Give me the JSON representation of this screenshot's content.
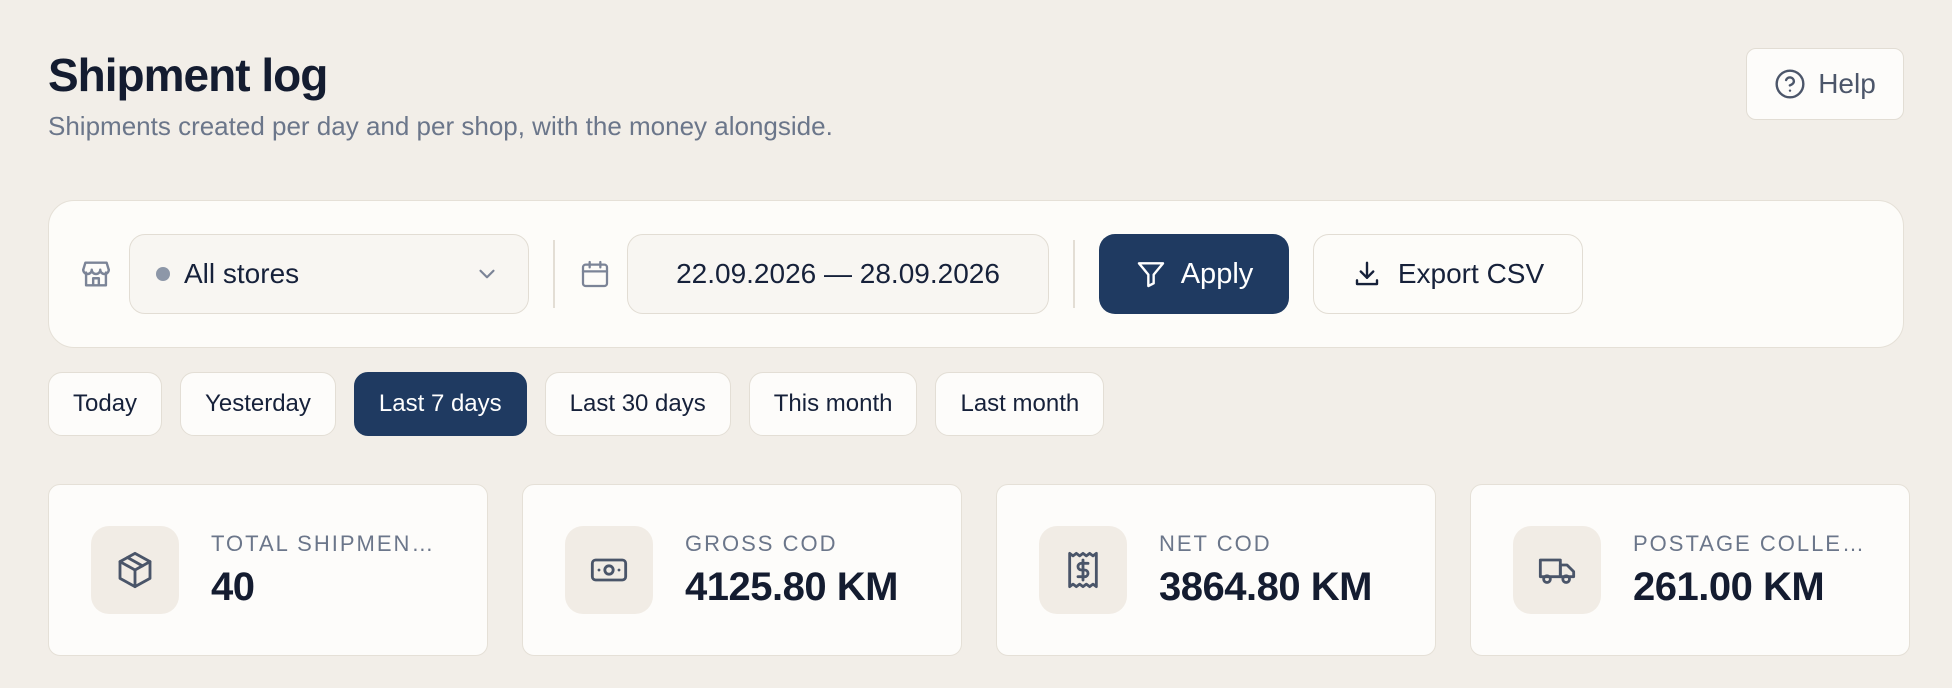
{
  "header": {
    "title": "Shipment log",
    "subtitle": "Shipments created per day and per shop, with the money alongside."
  },
  "help": {
    "label": "Help",
    "icon": "help-circle-icon"
  },
  "filters": {
    "store_icon": "store-icon",
    "store_select": {
      "value": "All stores"
    },
    "calendar_icon": "calendar-icon",
    "date_range": "22.09.2026 — 28.09.2026",
    "apply_label": "Apply",
    "export_label": "Export CSV"
  },
  "presets": [
    {
      "label": "Today",
      "active": false
    },
    {
      "label": "Yesterday",
      "active": false
    },
    {
      "label": "Last 7 days",
      "active": true
    },
    {
      "label": "Last 30 days",
      "active": false
    },
    {
      "label": "This month",
      "active": false
    },
    {
      "label": "Last month",
      "active": false
    }
  ],
  "stats": [
    {
      "label": "TOTAL SHIPMENTS",
      "value": "40",
      "icon": "package-icon"
    },
    {
      "label": "GROSS COD",
      "value": "4125.80 KM",
      "icon": "cash-icon"
    },
    {
      "label": "NET COD",
      "value": "3864.80 KM",
      "icon": "receipt-icon"
    },
    {
      "label": "POSTAGE COLLECTED",
      "value": "261.00 KM",
      "icon": "truck-icon"
    }
  ],
  "colors": {
    "background": "#f2eee8",
    "accent": "#1f3a61",
    "card": "#fdfcfa",
    "muted_text": "#6b768a"
  }
}
